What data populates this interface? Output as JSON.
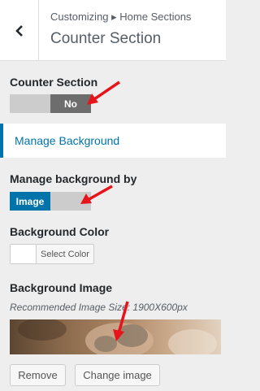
{
  "header": {
    "breadcrumb": "Customizing ▸ Home Sections",
    "title": "Counter Section",
    "back_icon": "chevron-left-icon"
  },
  "counter_section": {
    "label": "Counter Section",
    "toggle_value": "No"
  },
  "manage_background": {
    "label": "Manage Background"
  },
  "background_by": {
    "label": "Manage background by",
    "toggle_value": "Image"
  },
  "background_color": {
    "label": "Background Color",
    "button_label": "Select Color"
  },
  "background_image": {
    "label": "Background Image",
    "hint": "Recommended Image Size: 1900X600px",
    "remove_label": "Remove",
    "change_label": "Change image"
  },
  "colors": {
    "accent": "#0073aa",
    "annotation_arrow": "#e8141b"
  }
}
